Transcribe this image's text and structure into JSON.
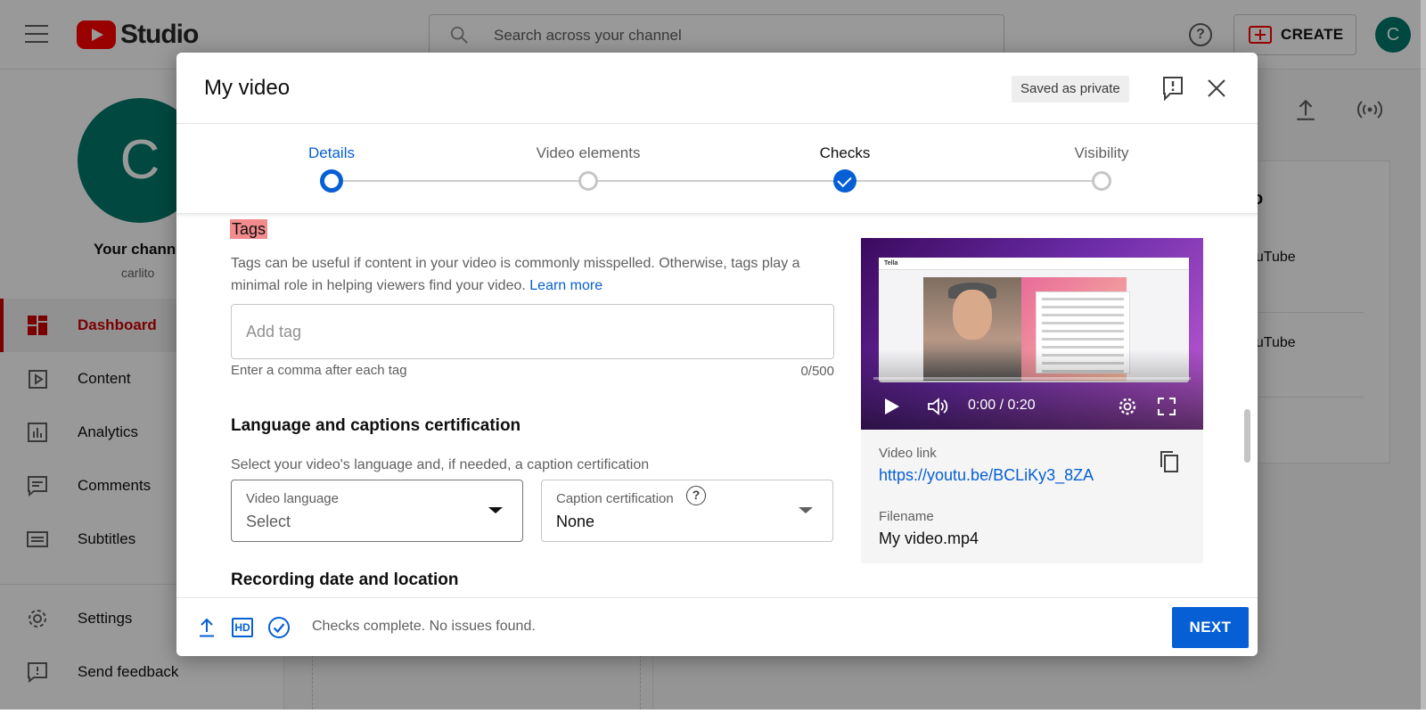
{
  "app": {
    "logo_text": "Studio",
    "search_placeholder": "Search across your channel",
    "create_label": "CREATE",
    "avatar_letter": "C"
  },
  "sidebar": {
    "avatar_letter": "C",
    "channel_title": "Your channel",
    "channel_handle": "carlito",
    "items": [
      {
        "label": "Dashboard",
        "icon": "dashboard-icon",
        "active": true
      },
      {
        "label": "Content",
        "icon": "content-icon"
      },
      {
        "label": "Analytics",
        "icon": "analytics-icon"
      },
      {
        "label": "Comments",
        "icon": "comments-icon"
      },
      {
        "label": "Subtitles",
        "icon": "subtitles-icon"
      },
      {
        "label": "Settings",
        "icon": "settings-icon"
      },
      {
        "label": "Send feedback",
        "icon": "feedback-icon"
      }
    ]
  },
  "background": {
    "card_title": "o",
    "card_line1": "ouTube",
    "card_line2": "ouTube"
  },
  "modal": {
    "title": "My video",
    "saved_badge": "Saved as private",
    "steps": [
      {
        "label": "Details",
        "state": "current"
      },
      {
        "label": "Video elements",
        "state": "pending"
      },
      {
        "label": "Checks",
        "state": "done"
      },
      {
        "label": "Visibility",
        "state": "pending"
      }
    ],
    "tags": {
      "heading": "Tags",
      "description": "Tags can be useful if content in your video is commonly misspelled. Otherwise, tags play a minimal role in helping viewers find your video.",
      "learn_more": "Learn more",
      "placeholder": "Add tag",
      "hint": "Enter a comma after each tag",
      "count": "0/500"
    },
    "language": {
      "heading": "Language and captions certification",
      "description": "Select your video's language and, if needed, a caption certification",
      "video_language_label": "Video language",
      "video_language_value": "Select",
      "caption_label": "Caption certification",
      "caption_value": "None"
    },
    "recording_heading": "Recording date and location",
    "preview": {
      "screen_logo": "Tella",
      "time": "0:00 / 0:20",
      "progress": 0,
      "video_link_label": "Video link",
      "video_link": "https://youtu.be/BCLiKy3_8ZA",
      "filename_label": "Filename",
      "filename": "My video.mp4"
    },
    "footer": {
      "hd_label": "HD",
      "status": "Checks complete. No issues found.",
      "next_label": "NEXT"
    }
  },
  "colors": {
    "accent": "#065fd4",
    "brand_red": "#ff0000",
    "highlight": "#f28b8b",
    "avatar": "#00796b"
  }
}
